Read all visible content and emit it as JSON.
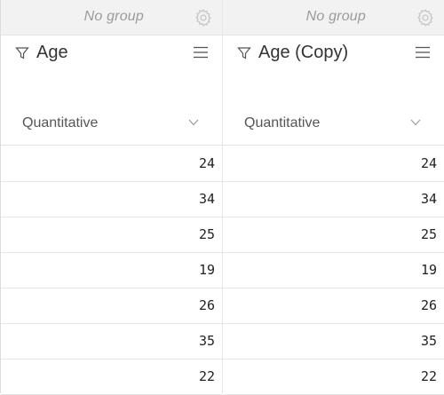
{
  "columns": [
    {
      "group_label": "No group",
      "title": "Age",
      "type": "Quantitative",
      "values": [
        "24",
        "34",
        "25",
        "19",
        "26",
        "35",
        "22"
      ]
    },
    {
      "group_label": "No group",
      "title": "Age (Copy)",
      "type": "Quantitative",
      "values": [
        "24",
        "34",
        "25",
        "19",
        "26",
        "35",
        "22"
      ]
    }
  ],
  "icons": {
    "group": "gear-icon",
    "filter": "filter-icon",
    "menu": "menu-icon",
    "dropdown": "chevron-down-icon"
  },
  "colors": {
    "group_bar_bg": "#f2f2f2",
    "border": "#e6e6e6",
    "muted_text": "#9a9a9a"
  }
}
